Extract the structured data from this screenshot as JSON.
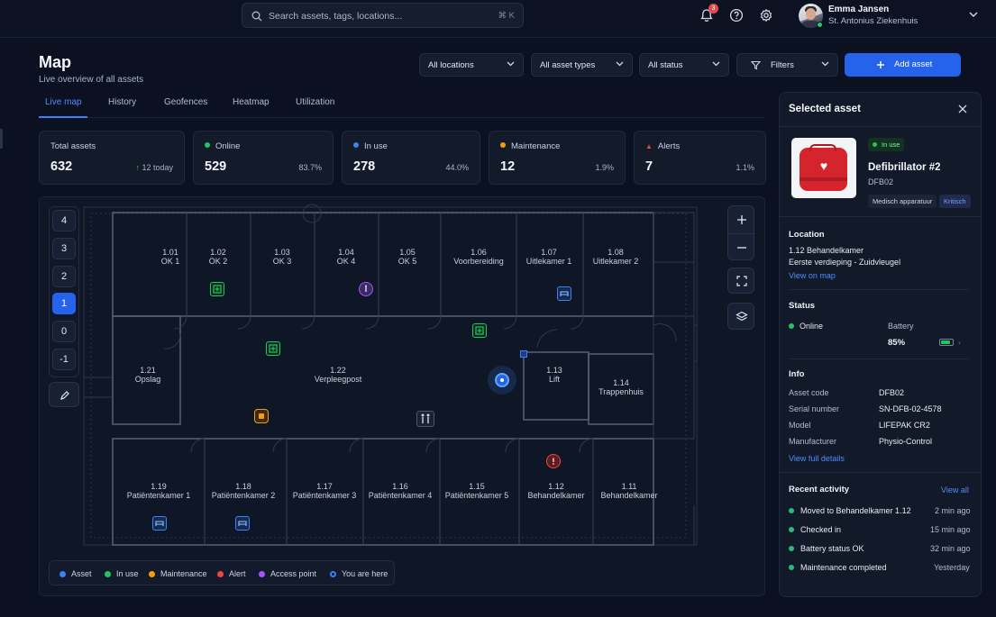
{
  "topbar": {
    "search_placeholder": "Search assets, tags, locations...",
    "search_shortcut": "⌘ K",
    "notification_count": "3",
    "user_name": "Emma Jansen",
    "user_org": "St. Antonius Ziekenhuis"
  },
  "page": {
    "title": "Map",
    "subtitle": "Live overview of all assets"
  },
  "filters": {
    "locations": "All locations",
    "asset_types": "All asset types",
    "status": "All status",
    "filters": "Filters",
    "add_asset": "Add asset"
  },
  "tabs": [
    "Live map",
    "History",
    "Geofences",
    "Heatmap",
    "Utilization"
  ],
  "stats": [
    {
      "label": "Total assets",
      "value": "632",
      "meta": "12 today",
      "color": "#22c55e"
    },
    {
      "label": "Online",
      "value": "529",
      "meta": "83.7%",
      "color": "#22c55e"
    },
    {
      "label": "In use",
      "value": "278",
      "meta": "44.0%",
      "color": "#3b82f6"
    },
    {
      "label": "Maintenance",
      "value": "12",
      "meta": "1.9%",
      "color": "#f59e0b"
    },
    {
      "label": "Alerts",
      "value": "7",
      "meta": "1.1%",
      "color": "#ef4444"
    }
  ],
  "floors": [
    "4",
    "3",
    "2",
    "1",
    "0",
    "-1"
  ],
  "active_floor": "1",
  "rooms": {
    "r101": {
      "num": "1.01",
      "name": "OK 1"
    },
    "r102": {
      "num": "1.02",
      "name": "OK 2"
    },
    "r103": {
      "num": "1.03",
      "name": "OK 3"
    },
    "r104": {
      "num": "1.04",
      "name": "OK 4"
    },
    "r105": {
      "num": "1.05",
      "name": "OK 5"
    },
    "r106": {
      "num": "1.06",
      "name": "Voorbereiding"
    },
    "r107": {
      "num": "1.07",
      "name": "Uitlekamer 1"
    },
    "r108": {
      "num": "1.08",
      "name": "Uitlekamer 2"
    },
    "r121": {
      "num": "1.21",
      "name": "Opslag"
    },
    "r122": {
      "num": "1.22",
      "name": "Verpleegpost"
    },
    "r113": {
      "num": "1.13",
      "name": "Lift"
    },
    "r114": {
      "num": "1.14",
      "name": "Trappenhuis"
    },
    "r119": {
      "num": "1.19",
      "name": "Patiëntenkamer 1"
    },
    "r118": {
      "num": "1.18",
      "name": "Patiëntenkamer 2"
    },
    "r117": {
      "num": "1.17",
      "name": "Patiëntenkamer 3"
    },
    "r116": {
      "num": "1.16",
      "name": "Patiëntenkamer 4"
    },
    "r115": {
      "num": "1.15",
      "name": "Patiëntenkamer 5"
    },
    "r112": {
      "num": "1.12",
      "name": "Behandelkamer"
    },
    "r111": {
      "num": "1.11",
      "name": "Behandelkamer"
    }
  },
  "legend": [
    "Asset",
    "In use",
    "Maintenance",
    "Alert",
    "Access point",
    "You are here"
  ],
  "legend_colors": [
    "#3b82f6",
    "#22c55e",
    "#f59e0b",
    "#ef4444",
    "#a855f7",
    "#3b82f6"
  ],
  "panel": {
    "title": "Selected asset",
    "status_badge": "In use",
    "asset_name": "Defibrillator #2",
    "asset_code_short": "DFB02",
    "tag1": "Medisch apparatuur",
    "tag2": "Kritisch",
    "location_heading": "Location",
    "location_room": "1.12 Behandelkamer",
    "location_floor": "Eerste verdieping - Zuidvleugel",
    "view_on_map": "View on map",
    "status_heading": "Status",
    "status_value": "Online",
    "battery_label": "Battery",
    "battery_value": "85%",
    "battery_level": 0.85,
    "info_heading": "Info",
    "info": [
      {
        "k": "Asset code",
        "v": "DFB02"
      },
      {
        "k": "Serial number",
        "v": "SN-DFB-02-4578"
      },
      {
        "k": "Model",
        "v": "LIFEPAK CR2"
      },
      {
        "k": "Manufacturer",
        "v": "Physio-Control"
      }
    ],
    "view_full_details": "View full details",
    "activity_heading": "Recent activity",
    "view_all": "View all",
    "activity": [
      {
        "text": "Moved to Behandelkamer 1.12",
        "time": "2 min ago"
      },
      {
        "text": "Checked in",
        "time": "15 min ago"
      },
      {
        "text": "Battery status OK",
        "time": "32 min ago"
      },
      {
        "text": "Maintenance completed",
        "time": "Yesterday"
      }
    ]
  }
}
